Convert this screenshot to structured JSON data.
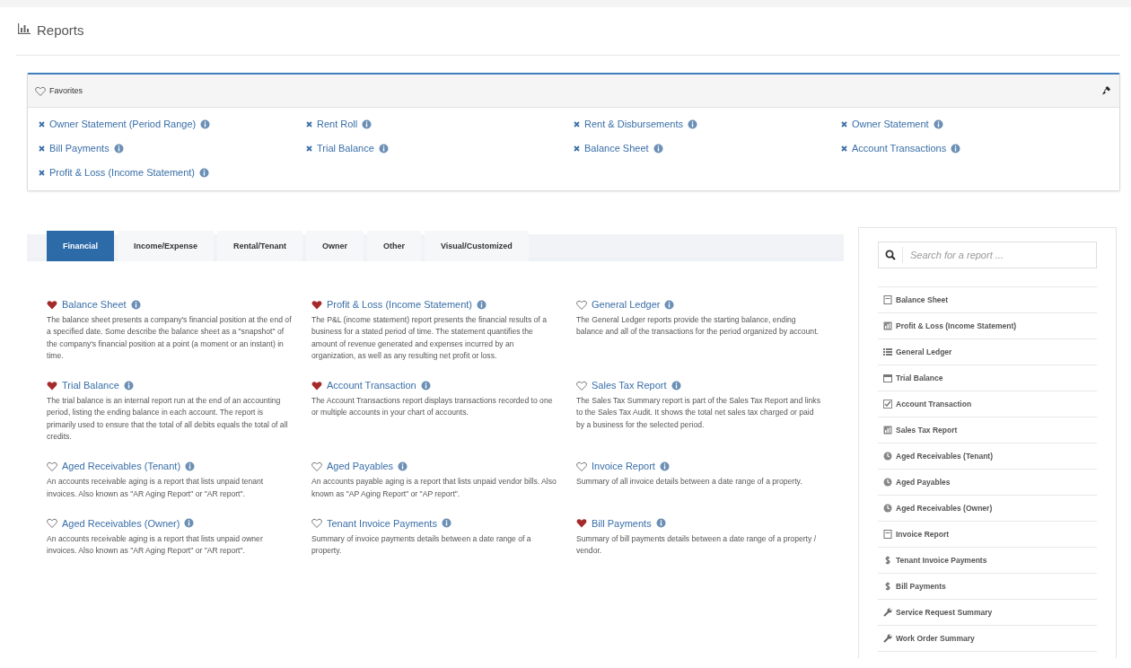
{
  "page": {
    "title": "Reports"
  },
  "favorites": {
    "title": "Favorites",
    "items": [
      {
        "label": "Owner Statement (Period Range)"
      },
      {
        "label": "Rent Roll"
      },
      {
        "label": "Rent & Disbursements"
      },
      {
        "label": "Owner Statement"
      },
      {
        "label": "Bill Payments"
      },
      {
        "label": "Trial Balance"
      },
      {
        "label": "Balance Sheet"
      },
      {
        "label": "Account Transactions"
      },
      {
        "label": "Profit & Loss (Income Statement)"
      }
    ]
  },
  "tabs": [
    {
      "label": "Financial",
      "selected": true
    },
    {
      "label": "Income/Expense",
      "selected": false
    },
    {
      "label": "Rental/Tenant",
      "selected": false
    },
    {
      "label": "Owner",
      "selected": false
    },
    {
      "label": "Other",
      "selected": false
    },
    {
      "label": "Visual/Customized",
      "selected": false
    }
  ],
  "reports": [
    {
      "title": "Balance Sheet",
      "favorite": true,
      "description": "The balance sheet presents a company's financial position at the end of a specified date. Some describe the balance sheet as a \"snapshot\" of the company's financial position at a point (a moment or an instant) in time."
    },
    {
      "title": "Profit & Loss (Income Statement)",
      "favorite": true,
      "description": "The P&L (income statement) report presents the financial results of a business for a stated period of time. The statement quantifies the amount of revenue generated and expenses incurred by an organization, as well as any resulting net profit or loss."
    },
    {
      "title": "General Ledger",
      "favorite": false,
      "description": "The General Ledger reports provide the starting balance, ending balance and all of the transactions for the period organized by account."
    },
    {
      "title": "Trial Balance",
      "favorite": true,
      "description": "The trial balance is an internal report run at the end of an accounting period, listing the ending balance in each account. The report is primarily used to ensure that the total of all debits equals the total of all credits."
    },
    {
      "title": "Account Transaction",
      "favorite": true,
      "description": "The Account Transactions report displays transactions recorded to one or multiple accounts in your chart of accounts."
    },
    {
      "title": "Sales Tax Report",
      "favorite": false,
      "description": "The Sales Tax Summary report is part of the Sales Tax Report and links to the Sales Tax Audit. It shows the total net sales tax charged or paid by a business for the selected period."
    },
    {
      "title": "Aged Receivables (Tenant)",
      "favorite": false,
      "description": "An accounts receivable aging is a report that lists unpaid tenant invoices. Also known as \"AR Aging Report\" or \"AR report\"."
    },
    {
      "title": "Aged Payables",
      "favorite": false,
      "description": "An accounts payable aging is a report that lists unpaid vendor bills. Also known as \"AP Aging Report\" or \"AP report\"."
    },
    {
      "title": "Invoice Report",
      "favorite": false,
      "description": "Summary of all invoice details between a date range of a property."
    },
    {
      "title": "Aged Receivables (Owner)",
      "favorite": false,
      "description": "An accounts receivable aging is a report that lists unpaid owner invoices. Also known as \"AR Aging Report\" or \"AR report\"."
    },
    {
      "title": "Tenant Invoice Payments",
      "favorite": false,
      "description": "Summary of invoice payments details between a date range of a property."
    },
    {
      "title": "Bill Payments",
      "favorite": true,
      "description": "Summary of bill payments details between a date range of a property / vendor."
    }
  ],
  "sidebar": {
    "search": {
      "placeholder": "Search for a report ..."
    },
    "items": [
      {
        "label": "Balance Sheet",
        "kind": "document"
      },
      {
        "label": "Profit & Loss (Income Statement)",
        "kind": "chart"
      },
      {
        "label": "General Ledger",
        "kind": "list"
      },
      {
        "label": "Trial Balance",
        "kind": "calendar"
      },
      {
        "label": "Account Transaction",
        "kind": "check"
      },
      {
        "label": "Sales Tax Report",
        "kind": "chart"
      },
      {
        "label": "Aged Receivables (Tenant)",
        "kind": "clock"
      },
      {
        "label": "Aged Payables",
        "kind": "clock"
      },
      {
        "label": "Aged Receivables (Owner)",
        "kind": "clock"
      },
      {
        "label": "Invoice Report",
        "kind": "document"
      },
      {
        "label": "Tenant Invoice Payments",
        "kind": "dollar"
      },
      {
        "label": "Bill Payments",
        "kind": "dollar"
      },
      {
        "label": "Service Request Summary",
        "kind": "wrench"
      },
      {
        "label": "Work Order Summary",
        "kind": "wrench"
      }
    ]
  }
}
